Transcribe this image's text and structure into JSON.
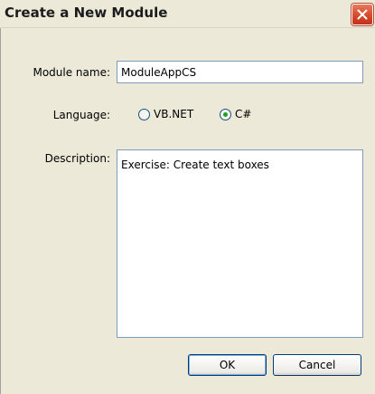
{
  "window": {
    "title": "Create a New Module"
  },
  "form": {
    "module_name_label": "Module name:",
    "module_name_value": "ModuleAppCS",
    "language_label": "Language:",
    "language_options": [
      {
        "label": "VB.NET",
        "selected": false
      },
      {
        "label": "C#",
        "selected": true
      }
    ],
    "description_label": "Description:",
    "description_value": "Exercise: Create text boxes"
  },
  "buttons": {
    "ok_label": "OK",
    "cancel_label": "Cancel"
  },
  "icons": {
    "close": "close-icon"
  },
  "colors": {
    "close_button": "#d6492d",
    "radio_selected": "#21a121",
    "field_border": "#7f9db9"
  }
}
